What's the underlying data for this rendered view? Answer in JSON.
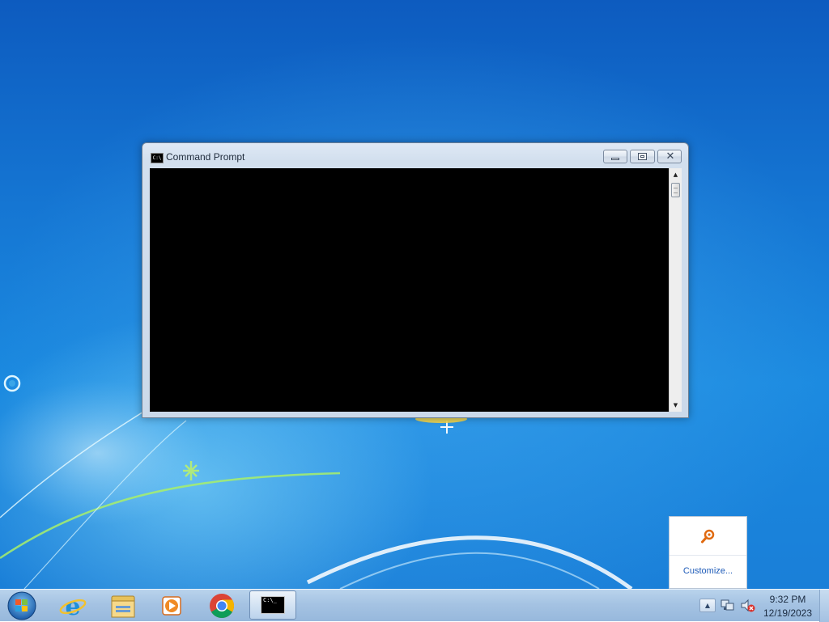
{
  "window": {
    "title": "Command Prompt",
    "icon": "cmd-icon",
    "controls": [
      "minimize",
      "maximize",
      "close"
    ]
  },
  "tray_flyout": {
    "icon": "magnifier-key-icon",
    "customize_label": "Customize..."
  },
  "taskbar": {
    "pinned": [
      "start-orb-icon",
      "internet-explorer-icon",
      "file-explorer-icon",
      "media-player-icon",
      "chrome-icon",
      "cmd-icon"
    ],
    "active_app": "cmd-icon",
    "cmd_glyph_text": "C:\\_",
    "tray_icons": [
      "show-hidden-icons",
      "network-icon",
      "volume-muted-icon"
    ],
    "clock_time": "9:32 PM",
    "clock_date": "12/19/2023"
  },
  "colors": {
    "desktop": "#1576d3",
    "taskbar": "#a5c3e3",
    "console_bg": "#000000",
    "link": "#1e5bb8"
  }
}
